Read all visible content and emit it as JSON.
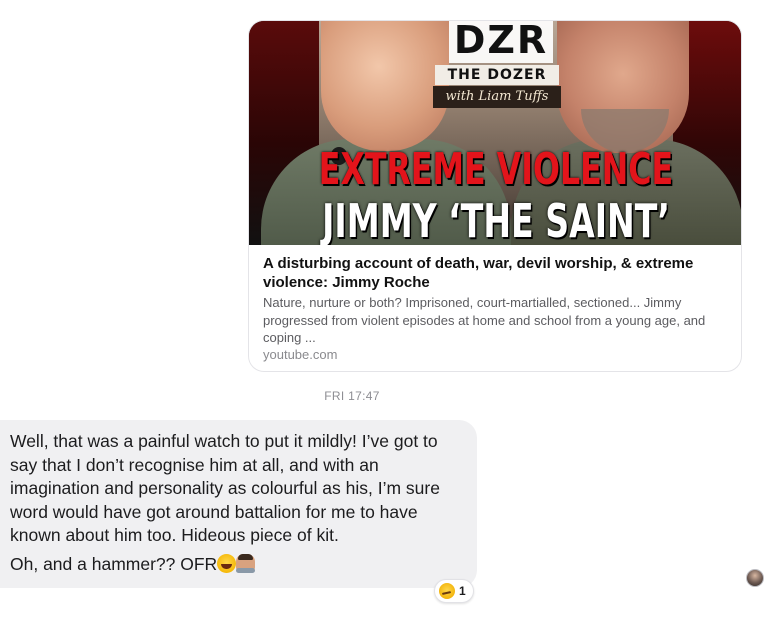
{
  "link_preview": {
    "thumbnail": {
      "logo_text": "DZR",
      "show_title": "THE DOZER",
      "show_subtitle": "with Liam Tuffs",
      "headline_line1": "EXTREME VIOLENCE",
      "headline_line2": "JIMMY ‘THE SAINT’"
    },
    "title": "A disturbing account of death, war, devil worship, & extreme violence: Jimmy Roche",
    "description": "Nature, nurture or both? Imprisoned, court-martialled, sectioned... Jimmy progressed from violent episodes at home and school from a young age, and coping ...",
    "domain": "youtube.com"
  },
  "timestamp": "FRI 17:47",
  "message": {
    "paragraph1": "Well, that was a painful watch to put it mildly! I’ve got to say that I don’t recognise him at all, and with an imagination and personality as colourful as his, I’m sure word would have got around battalion for me to have known about him too. Hideous piece of kit.",
    "paragraph2": "Oh, and a hammer?? OFR",
    "emojis": [
      "laughing-tears-emoji",
      "man-facepalm-emoji"
    ],
    "reaction": {
      "emoji": "grimace-face-emoji",
      "count": "1"
    }
  },
  "colors": {
    "bubble_background": "#f0f0f2",
    "headline_red": "#e3141b",
    "timestamp_gray": "#8e8e93"
  }
}
